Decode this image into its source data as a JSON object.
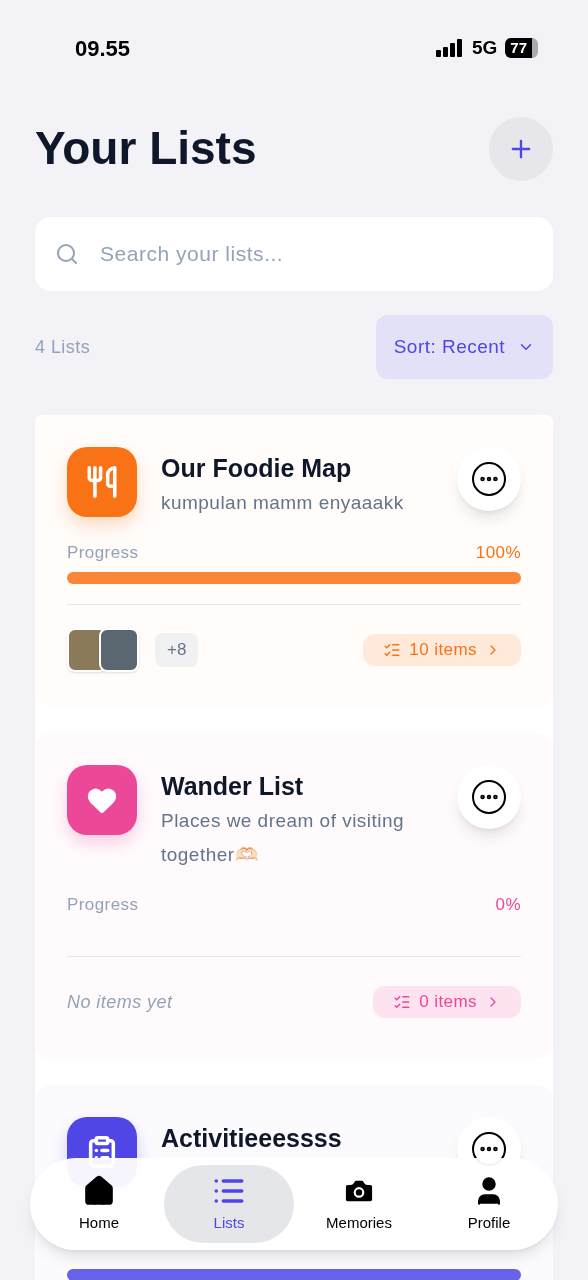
{
  "status_bar": {
    "time": "09.55",
    "network": "5G",
    "battery": "77"
  },
  "header": {
    "title": "Your Lists"
  },
  "search": {
    "placeholder": "Search your lists..."
  },
  "summary": {
    "count": "4 Lists",
    "sort": "Sort: Recent"
  },
  "lists": [
    {
      "kind": "food",
      "title": "Our Foodie Map",
      "description": "kumpulan mamm enyaaakk",
      "progress_label": "Progress",
      "percent": "100%",
      "level": 1,
      "color": "#f97316",
      "more": "+8",
      "items": "10 items"
    },
    {
      "kind": "heart",
      "title": "Wander List",
      "description": "Places we dream of visiting together🫶🏻",
      "progress_label": "Progress",
      "percent": "0%",
      "color": "#ec4899",
      "empty_text": "No items yet",
      "items": "0 items"
    },
    {
      "kind": "list",
      "title": "Activitieeessss",
      "level": 1,
      "color": "#4f46e5"
    }
  ],
  "nav": [
    {
      "kind": "home",
      "label": "Home",
      "selected": false
    },
    {
      "kind": "list",
      "label": "Lists",
      "selected": true
    },
    {
      "kind": "camera",
      "label": "Memories",
      "selected": false
    },
    {
      "kind": "person",
      "label": "Profile",
      "selected": false
    }
  ]
}
